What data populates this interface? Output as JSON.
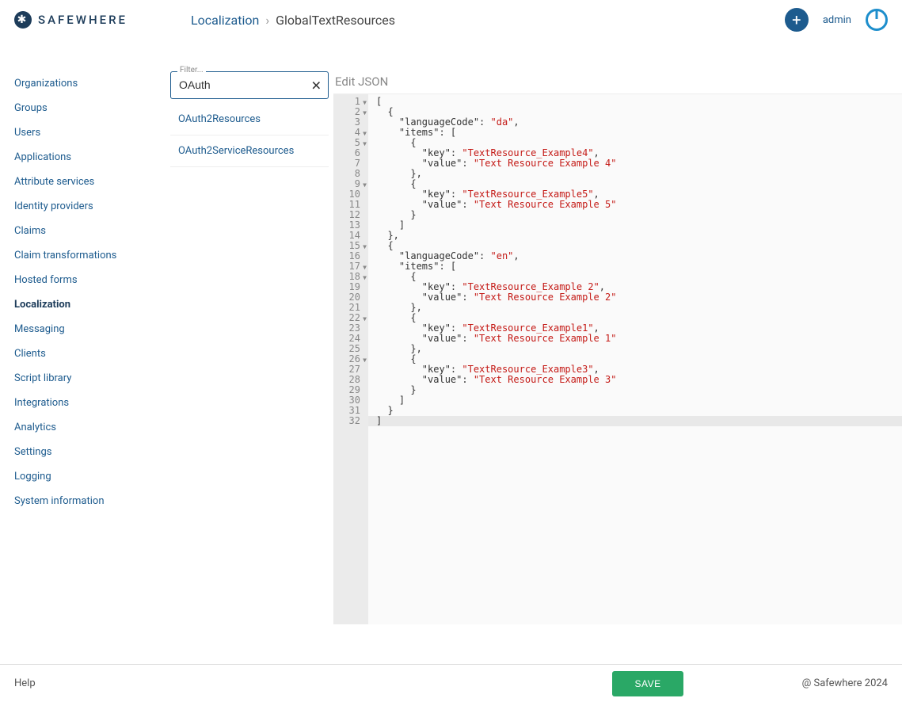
{
  "logo_text": "SAFEWHERE",
  "breadcrumb": {
    "link": "Localization",
    "sep": "›",
    "current": "GlobalTextResources"
  },
  "header": {
    "admin": "admin"
  },
  "sidebar": {
    "items": [
      "Organizations",
      "Groups",
      "Users",
      "Applications",
      "Attribute services",
      "Identity providers",
      "Claims",
      "Claim transformations",
      "Hosted forms",
      "Localization",
      "Messaging",
      "Clients",
      "Script library",
      "Integrations",
      "Analytics",
      "Settings",
      "Logging",
      "System information"
    ],
    "active_index": 9
  },
  "filter": {
    "label": "Filter...",
    "value": "OAuth"
  },
  "results": [
    "OAuth2Resources",
    "OAuth2ServiceResources"
  ],
  "editor": {
    "title": "Edit JSON",
    "lines": [
      {
        "n": 1,
        "fold": true,
        "t": "["
      },
      {
        "n": 2,
        "fold": true,
        "t": "  {"
      },
      {
        "n": 3,
        "t": "    \"languageCode\": ",
        "s": "\"da\"",
        "post": ","
      },
      {
        "n": 4,
        "fold": true,
        "t": "    \"items\": ["
      },
      {
        "n": 5,
        "fold": true,
        "t": "      {"
      },
      {
        "n": 6,
        "t": "        \"key\": ",
        "s": "\"TextResource_Example4\"",
        "post": ","
      },
      {
        "n": 7,
        "t": "        \"value\": ",
        "s": "\"Text Resource Example 4\""
      },
      {
        "n": 8,
        "t": "      },"
      },
      {
        "n": 9,
        "fold": true,
        "t": "      {"
      },
      {
        "n": 10,
        "t": "        \"key\": ",
        "s": "\"TextResource_Example5\"",
        "post": ","
      },
      {
        "n": 11,
        "t": "        \"value\": ",
        "s": "\"Text Resource Example 5\""
      },
      {
        "n": 12,
        "t": "      }"
      },
      {
        "n": 13,
        "t": "    ]"
      },
      {
        "n": 14,
        "t": "  },"
      },
      {
        "n": 15,
        "fold": true,
        "t": "  {"
      },
      {
        "n": 16,
        "t": "    \"languageCode\": ",
        "s": "\"en\"",
        "post": ","
      },
      {
        "n": 17,
        "fold": true,
        "t": "    \"items\": ["
      },
      {
        "n": 18,
        "fold": true,
        "t": "      {"
      },
      {
        "n": 19,
        "t": "        \"key\": ",
        "s": "\"TextResource_Example 2\"",
        "post": ","
      },
      {
        "n": 20,
        "t": "        \"value\": ",
        "s": "\"Text Resource Example 2\""
      },
      {
        "n": 21,
        "t": "      },"
      },
      {
        "n": 22,
        "fold": true,
        "t": "      {"
      },
      {
        "n": 23,
        "t": "        \"key\": ",
        "s": "\"TextResource_Example1\"",
        "post": ","
      },
      {
        "n": 24,
        "t": "        \"value\": ",
        "s": "\"Text Resource Example 1\""
      },
      {
        "n": 25,
        "t": "      },"
      },
      {
        "n": 26,
        "fold": true,
        "t": "      {"
      },
      {
        "n": 27,
        "t": "        \"key\": ",
        "s": "\"TextResource_Example3\"",
        "post": ","
      },
      {
        "n": 28,
        "t": "        \"value\": ",
        "s": "\"Text Resource Example 3\""
      },
      {
        "n": 29,
        "t": "      }"
      },
      {
        "n": 30,
        "t": "    ]"
      },
      {
        "n": 31,
        "t": "  }"
      },
      {
        "n": 32,
        "t": "]",
        "hl": true
      }
    ]
  },
  "footer": {
    "help": "Help",
    "save": "SAVE",
    "copyright": "@ Safewhere 2024"
  }
}
